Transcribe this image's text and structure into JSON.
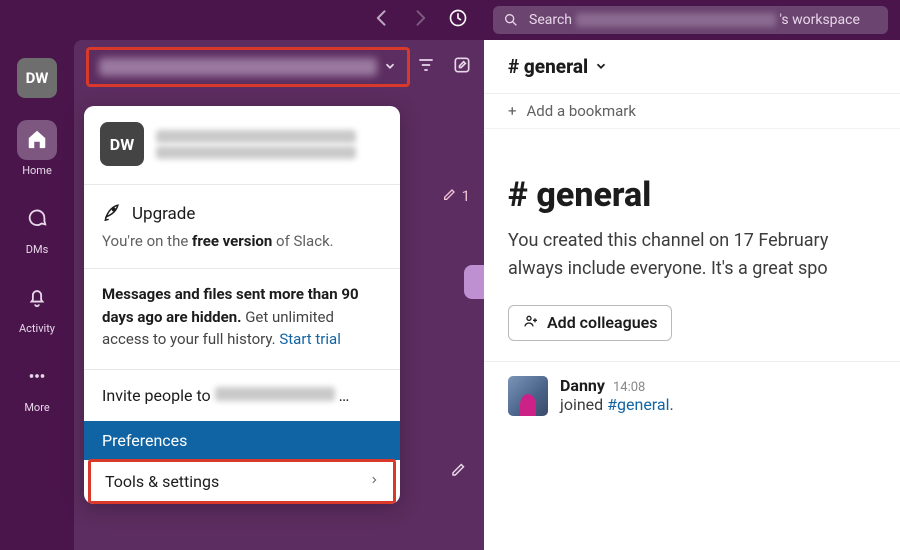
{
  "top": {
    "search_prefix": "Search",
    "search_suffix": "'s workspace"
  },
  "rail": {
    "ws_badge": "DW",
    "items": [
      {
        "label": "Home",
        "icon": "home-icon",
        "active": true
      },
      {
        "label": "DMs",
        "icon": "dms-icon",
        "active": false
      },
      {
        "label": "Activity",
        "icon": "bell-icon",
        "active": false
      },
      {
        "label": "More",
        "icon": "more-icon",
        "active": false
      }
    ]
  },
  "sidebar": {
    "draft_count": "1"
  },
  "menu": {
    "ws_badge": "DW",
    "upgrade_label": "Upgrade",
    "upgrade_sub_pre": "You're on the ",
    "upgrade_sub_bold": "free version",
    "upgrade_sub_post": " of Slack.",
    "info_bold": "Messages and files sent more than 90 days ago are hidden.",
    "info_rest": " Get unlimited access to your full history. ",
    "info_link": "Start trial",
    "invite_label": "Invite people to ",
    "invite_ellipsis": "…",
    "preferences_label": "Preferences",
    "tools_label": "Tools & settings"
  },
  "main": {
    "channel_name": "# general",
    "add_bookmark": "Add a bookmark",
    "intro_heading": "# general",
    "intro_text": "You created this channel on 17 February always include everyone. It's a great spo",
    "add_colleagues": "Add colleagues",
    "message": {
      "author": "Danny",
      "time": "14:08",
      "action": "joined ",
      "channel": "#general",
      "period": "."
    }
  }
}
